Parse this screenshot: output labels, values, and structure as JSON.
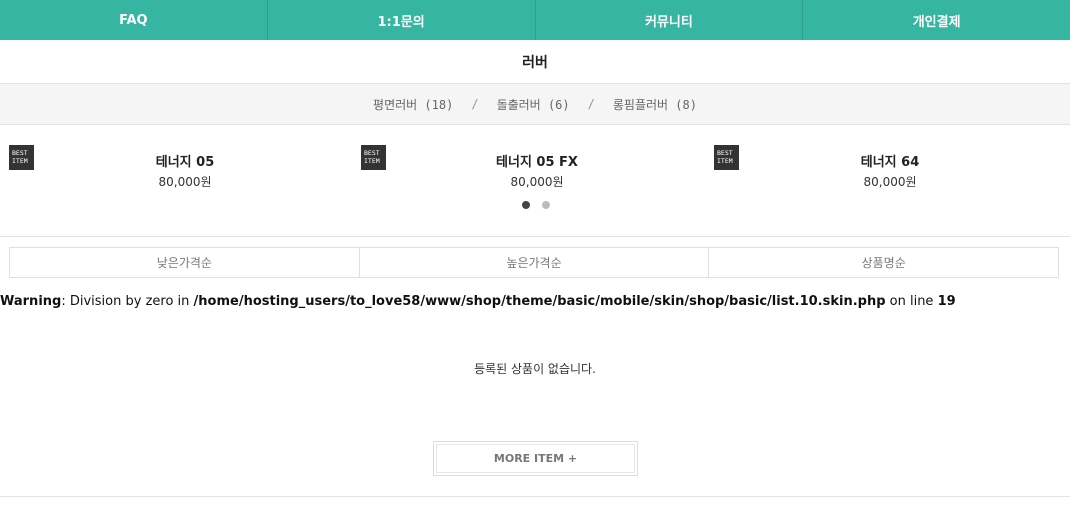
{
  "topnav": [
    {
      "label": "FAQ"
    },
    {
      "label": "1:1문의"
    },
    {
      "label": "커뮤니티"
    },
    {
      "label": "개인결제"
    }
  ],
  "category_title": "러버",
  "subcategories": [
    {
      "label": "평면러버 (18)"
    },
    {
      "label": "돌출러버 (6)"
    },
    {
      "label": "롱핌플러버 (8)"
    }
  ],
  "subcategory_separator": "/",
  "best_badge": {
    "line1": "BEST",
    "line2": "ITEM"
  },
  "best_items": [
    {
      "name": "테너지 05",
      "price": "80,000원"
    },
    {
      "name": "테너지 05 FX",
      "price": "80,000원"
    },
    {
      "name": "테너지 64",
      "price": "80,000원"
    }
  ],
  "carousel": {
    "pages": 2,
    "active_page": 1
  },
  "sort_options": [
    {
      "label": "낮은가격순"
    },
    {
      "label": "높은가격순"
    },
    {
      "label": "상품명순"
    }
  ],
  "warning": {
    "label": "Warning",
    "message": ": Division by zero in ",
    "path": "/home/hosting_users/to_love58/www/shop/theme/basic/mobile/skin/shop/basic/list.10.skin.php",
    "line_text": " on line ",
    "line_number": "19"
  },
  "empty_message": "등록된 상품이 없습니다.",
  "more_button": "MORE ITEM +"
}
